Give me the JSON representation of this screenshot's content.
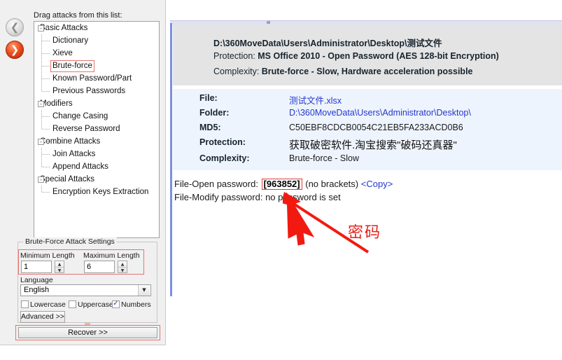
{
  "nav": {
    "back_icon": "circle-left-arrow-icon",
    "forward_icon": "circle-right-arrow-icon"
  },
  "sidebar": {
    "drag_hint": "Drag attacks from this list:",
    "tree": [
      {
        "label": "Basic Attacks",
        "level": 0,
        "expanded": true,
        "selected": false
      },
      {
        "label": "Dictionary",
        "level": 1,
        "expanded": false,
        "selected": false
      },
      {
        "label": "Xieve",
        "level": 1,
        "expanded": false,
        "selected": false
      },
      {
        "label": "Brute-force",
        "level": 1,
        "expanded": false,
        "selected": true
      },
      {
        "label": "Known Password/Part",
        "level": 1,
        "expanded": false,
        "selected": false
      },
      {
        "label": "Previous Passwords",
        "level": 1,
        "expanded": false,
        "selected": false
      },
      {
        "label": "Modifiers",
        "level": 0,
        "expanded": true,
        "selected": false
      },
      {
        "label": "Change Casing",
        "level": 1,
        "expanded": false,
        "selected": false
      },
      {
        "label": "Reverse Password",
        "level": 1,
        "expanded": false,
        "selected": false
      },
      {
        "label": "Combine Attacks",
        "level": 0,
        "expanded": true,
        "selected": false
      },
      {
        "label": "Join Attacks",
        "level": 1,
        "expanded": false,
        "selected": false
      },
      {
        "label": "Append Attacks",
        "level": 1,
        "expanded": false,
        "selected": false
      },
      {
        "label": "Special Attacks",
        "level": 0,
        "expanded": true,
        "selected": false
      },
      {
        "label": "Encryption Keys Extraction",
        "level": 1,
        "expanded": false,
        "selected": false
      }
    ],
    "expander_glyph": "-"
  },
  "settings": {
    "group_title": "Brute-Force Attack Settings",
    "min_length_label": "Minimum Length",
    "min_length_value": "1",
    "max_length_label": "Maximum Length",
    "max_length_value": "6",
    "language_label": "Language",
    "language_value": "English",
    "dropdown_icon": "chevron-down-icon",
    "spinner_up_icon": "chevron-up-icon",
    "spinner_down_icon": "chevron-down-icon",
    "checkboxes": [
      {
        "label": "Lowercase",
        "checked": false
      },
      {
        "label": "Uppercase",
        "checked": false
      },
      {
        "label": "Numbers",
        "checked": true
      }
    ],
    "advanced_label": "Advanced >>",
    "recover_label": "Recover >>"
  },
  "header": {
    "path": "D:\\360MoveData\\Users\\Administrator\\Desktop\\测试文件",
    "protection_label": "Protection:",
    "protection_value": "MS Office 2010 - Open Password (AES 128-bit Encryption)",
    "complexity_label": "Complexity:",
    "complexity_value": "Brute-force - Slow, Hardware acceleration possible"
  },
  "info": {
    "rows": [
      {
        "key": "File:",
        "value": "测试文件.xlsx",
        "style": "link"
      },
      {
        "key": "Folder:",
        "value": "D:\\360MoveData\\Users\\Administrator\\Desktop\\",
        "style": "link"
      },
      {
        "key": "MD5:",
        "value": "C50EBF8CDCB0054C21EB5FA233ACD0B6",
        "style": "plain"
      },
      {
        "key": "Protection:",
        "value": "获取破密软件.淘宝搜索\"破码还真器\"",
        "style": "cjk"
      },
      {
        "key": "Complexity:",
        "value": "Brute-force - Slow",
        "style": "plain"
      }
    ]
  },
  "result": {
    "open_label": "File-Open password:",
    "open_password": "[963852]",
    "open_note": "(no brackets)",
    "copy_link": "<Copy>",
    "modify_label": "File-Modify password:",
    "modify_value": "no password is set"
  },
  "annotation": {
    "text": "密码",
    "arrow_icon": "red-arrow-icon",
    "color": "#e8201a"
  },
  "colors": {
    "accent_blue": "#7b8fe0",
    "link_blue": "#2437cf",
    "highlight_red": "#e8736d",
    "info_bg": "#eef4fd",
    "header_bg": "#e4e4e4"
  }
}
